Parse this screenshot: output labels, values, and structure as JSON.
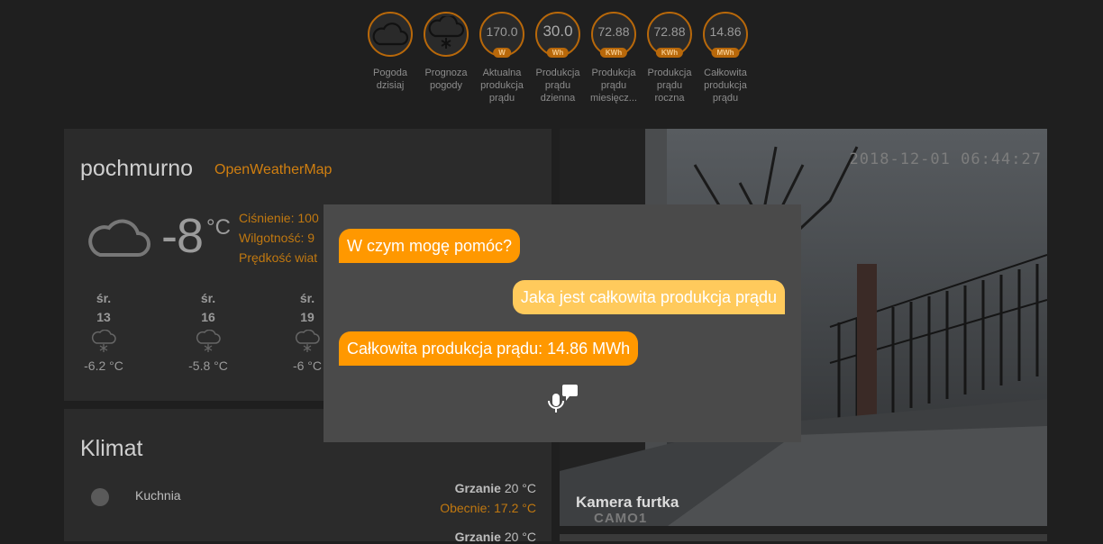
{
  "badges": [
    {
      "value": "",
      "unit": "",
      "label": "Pogoda dzisiaj",
      "icon": "cloud-icon"
    },
    {
      "value": "",
      "unit": "",
      "label": "Prognoza pogody",
      "icon": "snow-cloud-icon"
    },
    {
      "value": "170.0",
      "unit": "W",
      "label": "Aktualna produkcja prądu"
    },
    {
      "value": "30.0",
      "unit": "Wh",
      "label": "Produkcja prądu dzienna"
    },
    {
      "value": "72.88",
      "unit": "KWh",
      "label": "Produkcja prądu miesięcz..."
    },
    {
      "value": "72.88",
      "unit": "KWh",
      "label": "Produkcja prądu roczna"
    },
    {
      "value": "14.86",
      "unit": "MWh",
      "label": "Całkowita produkcja prądu"
    }
  ],
  "weather": {
    "condition": "pochmurno",
    "source": "OpenWeatherMap",
    "temperature": "-8",
    "unit": "°C",
    "pressure": "Ciśnienie: 100",
    "humidity": "Wilgotność: 9",
    "wind": "Prędkość wiat",
    "forecast": [
      {
        "day": "śr.",
        "date": "13",
        "temp": "-6.2 °C"
      },
      {
        "day": "śr.",
        "date": "16",
        "temp": "-5.8 °C"
      },
      {
        "day": "śr.",
        "date": "19",
        "temp": "-6 °C"
      }
    ]
  },
  "climate": {
    "title": "Klimat",
    "rows": [
      {
        "name": "Kuchnia",
        "mode": "Grzanie",
        "target": "20 °C",
        "current": "Obecnie: 17.2 °C"
      },
      {
        "name": "",
        "mode": "Grzanie",
        "target": "20 °C",
        "current": ""
      }
    ]
  },
  "camera": {
    "timestamp": "2018-12-01 06:44:27",
    "name": "Kamera furtka",
    "id": "CAMO1"
  },
  "dialog": {
    "messages": [
      {
        "from": "bot",
        "text": "W czym mogę pomóc?"
      },
      {
        "from": "user",
        "text": "Jaka jest całkowita produkcja prądu"
      },
      {
        "from": "bot",
        "text": "Całkowita produkcja prądu: 14.86 MWh"
      }
    ],
    "mic_icon": "microphone-chat-icon"
  },
  "colors": {
    "accent": "#ff9800",
    "user_bubble": "#ffca5c",
    "badge_border": "#b8680a"
  }
}
